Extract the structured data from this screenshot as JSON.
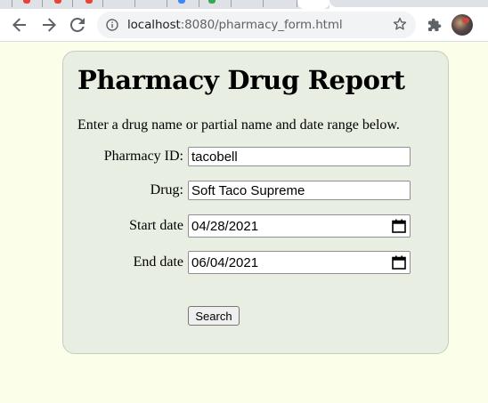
{
  "browser": {
    "url_host": "localhost",
    "url_rest": ":8080/pharmacy_form.html"
  },
  "page": {
    "title": "Pharmacy Drug Report",
    "intro": "Enter a drug name or partial name and date range below.",
    "pharmacy_id": {
      "label": "Pharmacy ID:",
      "value": "tacobell"
    },
    "drug": {
      "label": "Drug:",
      "value": "Soft Taco Supreme"
    },
    "start_date": {
      "label": "Start date",
      "value": "04/28/2021"
    },
    "end_date": {
      "label": "End date",
      "value": "06/04/2021"
    },
    "search_label": "Search"
  },
  "colors": {
    "page_background": "#fbffe9",
    "card_background": "#e8eee2"
  }
}
